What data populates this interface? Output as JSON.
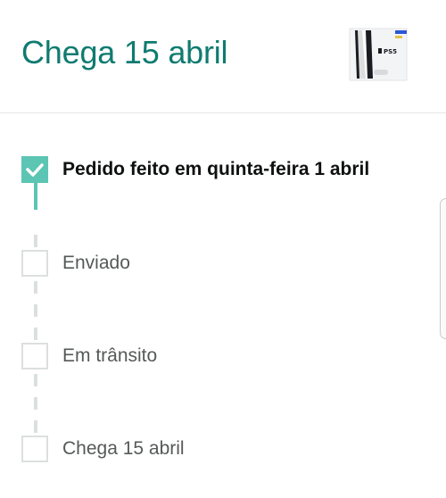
{
  "header": {
    "delivery_title": "Chega 15 abril",
    "product_image_text": "PS5"
  },
  "timeline": {
    "steps": [
      {
        "label": "Pedido feito em quinta-feira 1 abril",
        "completed": true
      },
      {
        "label": "Enviado",
        "completed": false
      },
      {
        "label": "Em trânsito",
        "completed": false
      },
      {
        "label": "Chega 15 abril",
        "completed": false
      }
    ]
  },
  "colors": {
    "accent_teal": "#0f7b70",
    "check_teal": "#5cc5b3",
    "inactive_gray": "#dcdfe0"
  }
}
